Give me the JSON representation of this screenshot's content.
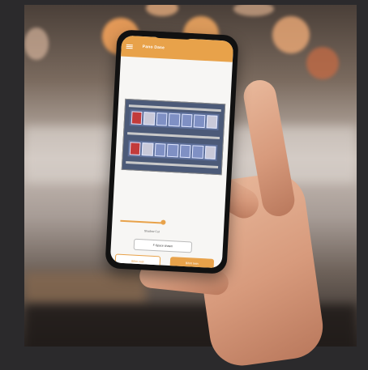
{
  "scene": {
    "description_type": "photo",
    "phone_app": {
      "title": "Pano Dase",
      "slider_label": "Shadow Cut",
      "outline_button_label": "F-Space shasm",
      "bottom_left_button_label": "Bifon cast",
      "bottom_right_button_label": "Bifort tmin"
    },
    "colors": {
      "accent": "#e8a24a",
      "background": "#2b2a2c"
    }
  }
}
